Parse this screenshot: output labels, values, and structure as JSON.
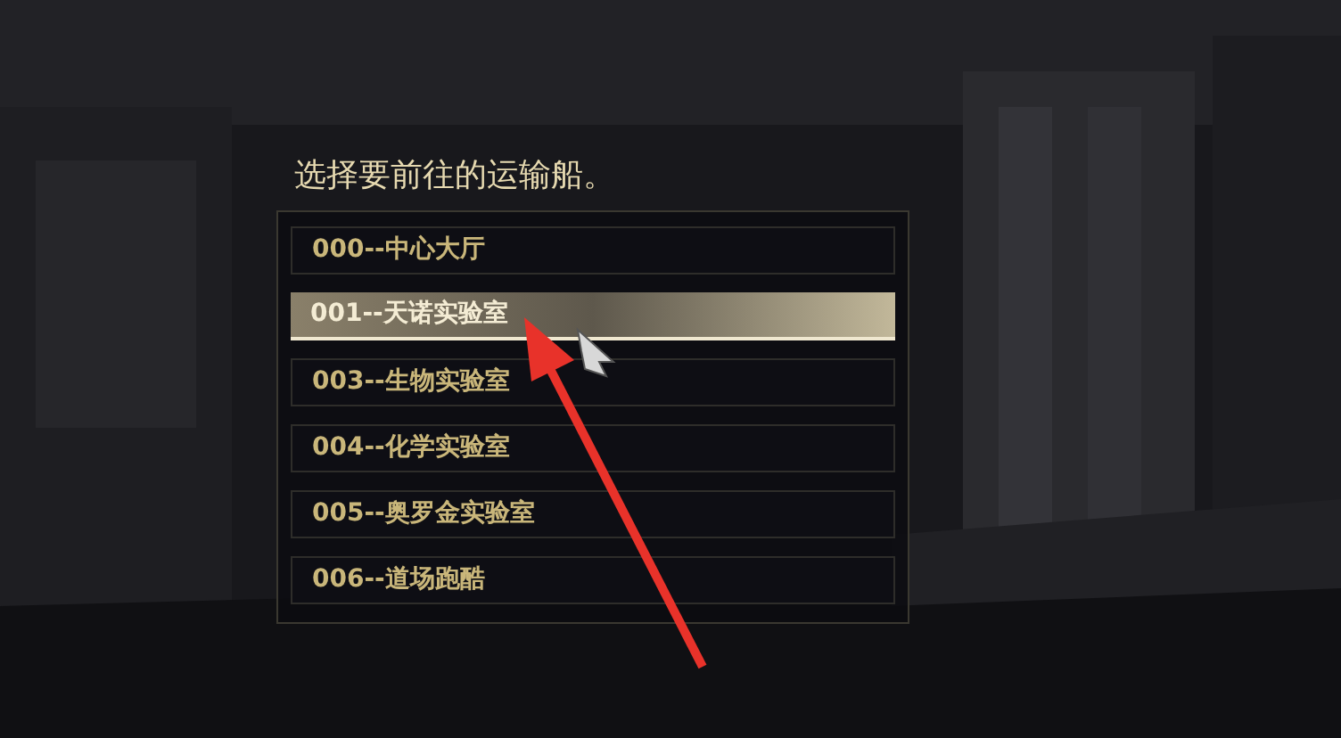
{
  "dialog": {
    "title": "选择要前往的运输船。",
    "options": [
      {
        "label": "000--中心大厅",
        "selected": false
      },
      {
        "label": "001--天诺实验室",
        "selected": true
      },
      {
        "label": "003--生物实验室",
        "selected": false
      },
      {
        "label": "004--化学实验室",
        "selected": false
      },
      {
        "label": "005--奥罗金实验室",
        "selected": false
      },
      {
        "label": "006--道场跑酷",
        "selected": false
      }
    ]
  }
}
